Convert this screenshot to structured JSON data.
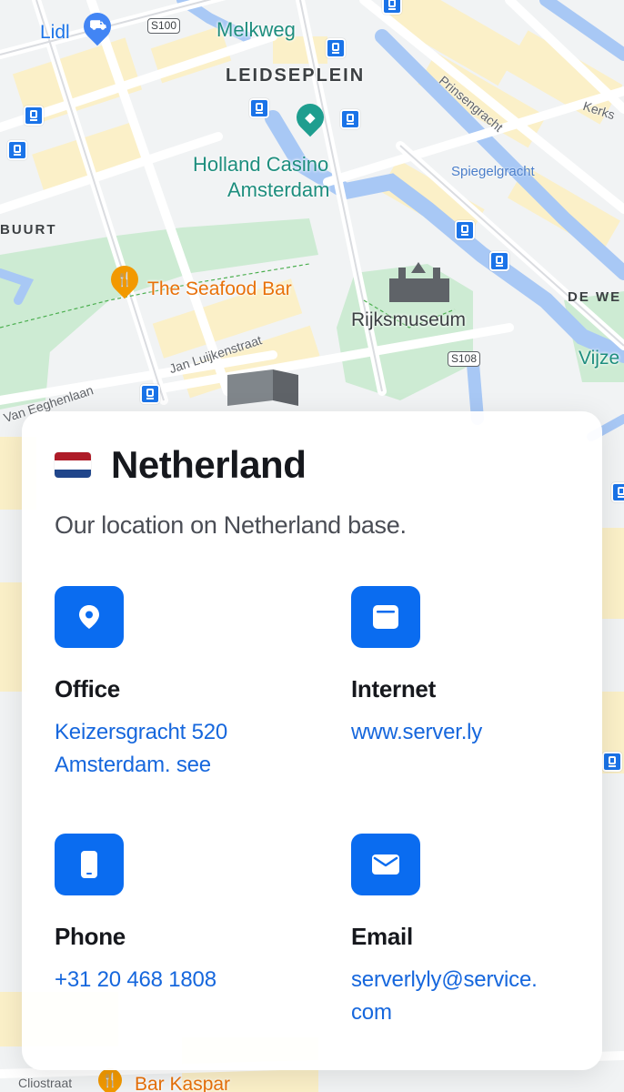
{
  "map": {
    "places": {
      "lidl": "Lidl",
      "melkweg": "Melkweg",
      "leidseplein": "LEIDSEPLEIN",
      "casino_line1": "Holland Casino",
      "casino_line2": "Amsterdam",
      "seafood": "The Seafood Bar",
      "rijksmuseum": "Rijksmuseum",
      "buurt": "BUURT",
      "de_we": "DE WE",
      "vijze": "Vijze",
      "bar_kaspar": "Bar Kaspar"
    },
    "streets": {
      "prinsengracht": "Prinsengracht",
      "spiegelgracht": "Spiegelgracht",
      "kerks": "Kerks",
      "jan_luijken": "Jan Luijkenstraat",
      "van_eeghen": "Van Eeghenlaan",
      "cliostraat": "Cliostraat"
    },
    "shields": {
      "s100": "S100",
      "s108": "S108"
    }
  },
  "card": {
    "title": "Netherland",
    "subtitle": "Our location on Netherland base.",
    "flag_colors": [
      "#ae1c28",
      "#ffffff",
      "#21468b"
    ],
    "accent_color": "#0a6cf0",
    "link_color": "#1667dd",
    "items": [
      {
        "icon": "location-pin-icon",
        "title": "Office",
        "lines": [
          "Keizersgracht 520",
          "Amsterdam. see"
        ]
      },
      {
        "icon": "browser-window-icon",
        "title": "Internet",
        "lines": [
          "www.server.ly"
        ]
      },
      {
        "icon": "phone-icon",
        "title": "Phone",
        "lines": [
          "+31 20 468 1808"
        ]
      },
      {
        "icon": "envelope-icon",
        "title": "Email",
        "lines": [
          "serverlyly@service.",
          "com"
        ]
      }
    ]
  }
}
